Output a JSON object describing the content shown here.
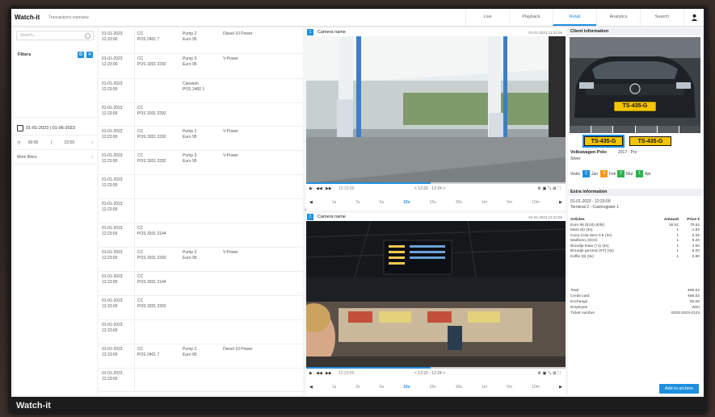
{
  "app": {
    "brand": "Watch-it",
    "subtitle": "Transactions overview",
    "monitor_label": "Watch-it"
  },
  "nav": {
    "tabs": [
      {
        "label": "Live",
        "active": false
      },
      {
        "label": "Playback",
        "active": false
      },
      {
        "label": "Retail",
        "active": true
      },
      {
        "label": "Analytics",
        "active": false
      },
      {
        "label": "Search",
        "active": false
      }
    ]
  },
  "filters": {
    "search_placeholder": "Search...",
    "title": "Filters",
    "date_range": "01-01-2023 | 01-06-2023",
    "time_from": "00:00",
    "time_sep": "|",
    "time_to": "23:59",
    "more_filters": "More filters"
  },
  "transactions": [
    {
      "date": "01-01-2023",
      "time": "12:23:00",
      "card": "CC",
      "terminal": "POS 2401 7",
      "pump": "Pump 2",
      "fuel": "Euro 95",
      "note": "Diesel 10 Power"
    },
    {
      "date": "01-01-2023",
      "time": "12:23:00",
      "card": "CC",
      "terminal": "POS 3201 2292",
      "pump": "Pump 3",
      "fuel": "Euro 95",
      "note": "V-Power"
    },
    {
      "date": "01-01-2023",
      "time": "12:23:00",
      "card": "",
      "terminal": "",
      "pump": "Carwash",
      "fuel": "POS 2400 1",
      "note": ""
    },
    {
      "date": "01-01-2023",
      "time": "12:23:00",
      "card": "CC",
      "terminal": "POS 3201 2292",
      "pump": "",
      "fuel": "",
      "note": ""
    },
    {
      "date": "01-01-2023",
      "time": "12:23:00",
      "card": "CC",
      "terminal": "POS 3201 2292",
      "pump": "Pump 2",
      "fuel": "Euro 95",
      "note": "V-Power"
    },
    {
      "date": "01-01-2023",
      "time": "12:23:00",
      "card": "CC",
      "terminal": "POS 3201 2292",
      "pump": "Pump 3",
      "fuel": "Euro 95",
      "note": "V-Power"
    },
    {
      "date": "01-01-2023",
      "time": "12:23:00",
      "card": "",
      "terminal": "",
      "pump": "",
      "fuel": "",
      "note": ""
    },
    {
      "date": "01-01-2023",
      "time": "12:23:00",
      "card": "",
      "terminal": "",
      "pump": "",
      "fuel": "",
      "note": ""
    },
    {
      "date": "01-01-2023",
      "time": "12:23:00",
      "card": "CC",
      "terminal": "POS 3201 2144",
      "pump": "",
      "fuel": "",
      "note": ""
    },
    {
      "date": "01-01-2023",
      "time": "12:23:00",
      "card": "CC",
      "terminal": "POS 3201 2292",
      "pump": "Pump 2",
      "fuel": "Euro 95",
      "note": "V-Power"
    },
    {
      "date": "01-01-2023",
      "time": "12:23:00",
      "card": "CC",
      "terminal": "POS 3201 2144",
      "pump": "",
      "fuel": "",
      "note": ""
    },
    {
      "date": "01-01-2023",
      "time": "12:23:00",
      "card": "CC",
      "terminal": "POS 3201 2292",
      "pump": "",
      "fuel": "",
      "note": ""
    },
    {
      "date": "01-01-2023",
      "time": "12:23:00",
      "card": "",
      "terminal": "",
      "pump": "",
      "fuel": "",
      "note": ""
    },
    {
      "date": "01-01-2023",
      "time": "12:23:00",
      "card": "CC",
      "terminal": "POS 2401 7",
      "pump": "Pump 2",
      "fuel": "Euro 95",
      "note": "Diesel 10 Power"
    },
    {
      "date": "01-01-2023",
      "time": "12:23:00",
      "card": "",
      "terminal": "",
      "pump": "",
      "fuel": "",
      "note": ""
    }
  ],
  "cameras": [
    {
      "badge": "1",
      "title": "Camera name",
      "date": "01-01-2023 12:23:00",
      "controls_time": "12:23:00",
      "range": "< 12:22 - 12:24 >"
    },
    {
      "badge": "2",
      "title": "Camera name",
      "date": "01-01-2023 12:23:00",
      "controls_time": "12:23:00",
      "range": "< 12:22 - 12:24 >"
    }
  ],
  "timeline": [
    "1s",
    "2s",
    "5s",
    "10s",
    "15s",
    "30s",
    "1m",
    "5m",
    "10m"
  ],
  "client": {
    "section_title": "Client information",
    "plate": "TS-435-G",
    "car_model": "Volkswagen Polo",
    "car_year": "2017 - Pre",
    "car_color": "Silver",
    "visits_label": "Visits",
    "chips": [
      {
        "value": "2",
        "label": "Jan",
        "color": "#1d8fe0"
      },
      {
        "value": "4",
        "label": "Feb",
        "color": "#f39a1d"
      },
      {
        "value": "2",
        "label": "Mar",
        "color": "#2bb24c"
      },
      {
        "value": "1",
        "label": "Apr",
        "color": "#2bb24c"
      }
    ]
  },
  "receipt": {
    "section_title": "Extra information",
    "line1": "01-01-2023 - 12:23:00",
    "line2": "Terminal 2 - Cashregister 1",
    "headers": [
      "Articles",
      "Amount",
      "Price €"
    ],
    "items": [
      {
        "name": "Euro 95 (E10) (€/ltr)",
        "amount": "36.52",
        "price": "70.62"
      },
      {
        "name": "Mars (6) (3x)",
        "amount": "1",
        "price": "1.50"
      },
      {
        "name": "Coca Cola Zero 0.5 (3x)",
        "amount": "1",
        "price": "2.35"
      },
      {
        "name": "Marlboro (SOS)",
        "amount": "1",
        "price": "9.20"
      },
      {
        "name": "Broodje kaas (+1) (3x)",
        "amount": "1",
        "price": "4.50"
      },
      {
        "name": "Broodje gezond (ST) (3x)",
        "amount": "1",
        "price": "5.00"
      },
      {
        "name": "Koffie (9) (3x)",
        "amount": "1",
        "price": "2.80"
      }
    ],
    "summary": [
      {
        "label": "Total",
        "value": "€96.02"
      },
      {
        "label": "Credit card",
        "value": "€96.02"
      },
      {
        "label": "Exchange",
        "value": "€0.00"
      },
      {
        "label": "Employee",
        "value": "Wim"
      },
      {
        "label": "Ticket number",
        "value": "0033-2023-0123"
      }
    ],
    "archive_button": "Add to archive"
  }
}
